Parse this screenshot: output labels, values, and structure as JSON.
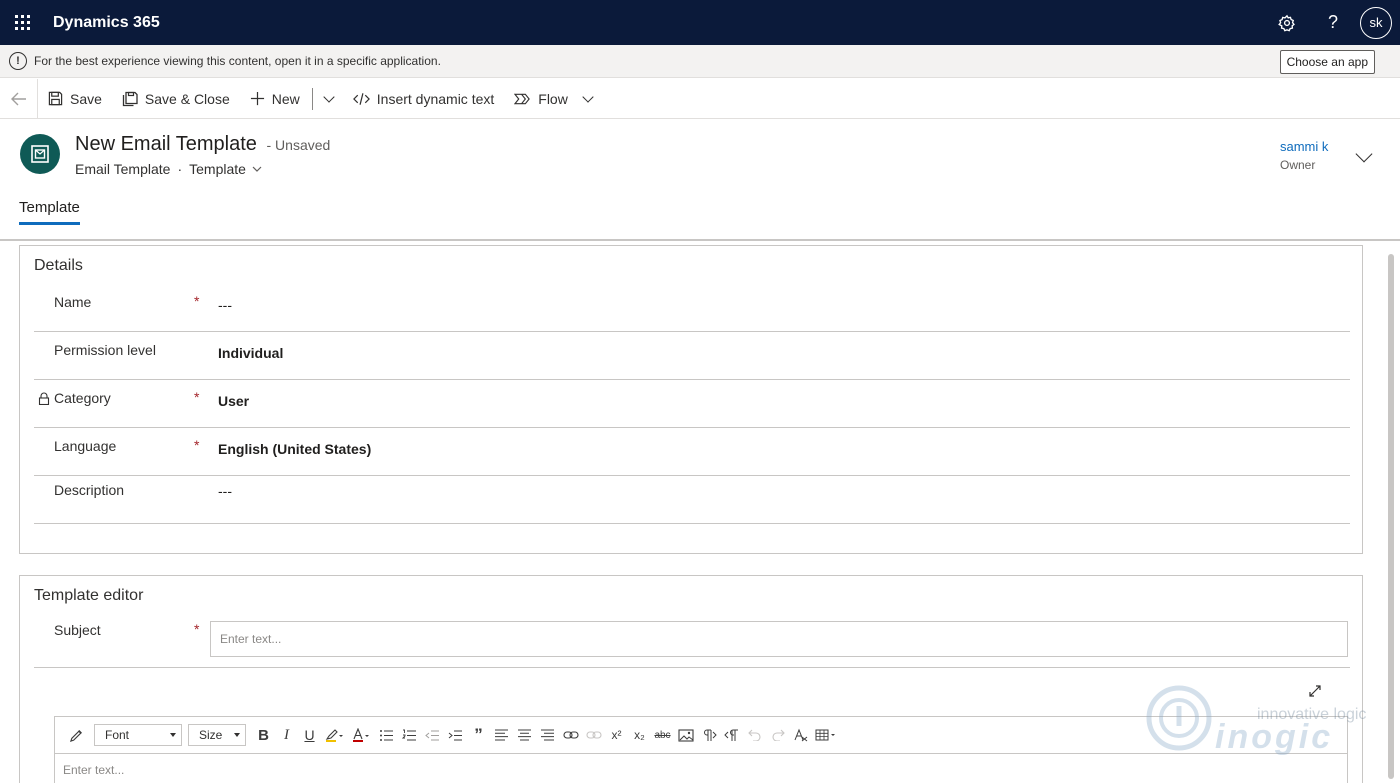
{
  "topnav": {
    "app_title": "Dynamics 365",
    "settings_icon": "gear-icon",
    "help_label": "?",
    "avatar_initials": "sk"
  },
  "notification": {
    "text": "For the best experience viewing this content, open it in a specific application.",
    "button_label": "Choose an app"
  },
  "commandbar": {
    "save_label": "Save",
    "save_close_label": "Save & Close",
    "new_label": "New",
    "insert_dynamic_label": "Insert dynamic text",
    "flow_label": "Flow"
  },
  "header": {
    "title": "New Email Template",
    "status": "- Unsaved",
    "entity": "Email Template",
    "separator": "·",
    "form": "Template",
    "owner_name": "sammi k",
    "owner_label": "Owner"
  },
  "tabs": [
    {
      "label": "Template"
    }
  ],
  "details": {
    "title": "Details",
    "fields": [
      {
        "label": "Name",
        "required": "*",
        "value": "---"
      },
      {
        "label": "Permission level",
        "required": "",
        "value": "Individual"
      },
      {
        "label": "Category",
        "required": "*",
        "value": "User"
      },
      {
        "label": "Language",
        "required": "*",
        "value": "English (United States)"
      },
      {
        "label": "Description",
        "required": "",
        "value": "---"
      }
    ]
  },
  "editor": {
    "title": "Template editor",
    "subject_label": "Subject",
    "subject_required": "*",
    "subject_placeholder": "Enter text...",
    "font_label": "Font",
    "size_label": "Size",
    "body_placeholder": "Enter text..."
  },
  "watermark": {
    "line1": "innovative logic",
    "line2": "inogic"
  }
}
